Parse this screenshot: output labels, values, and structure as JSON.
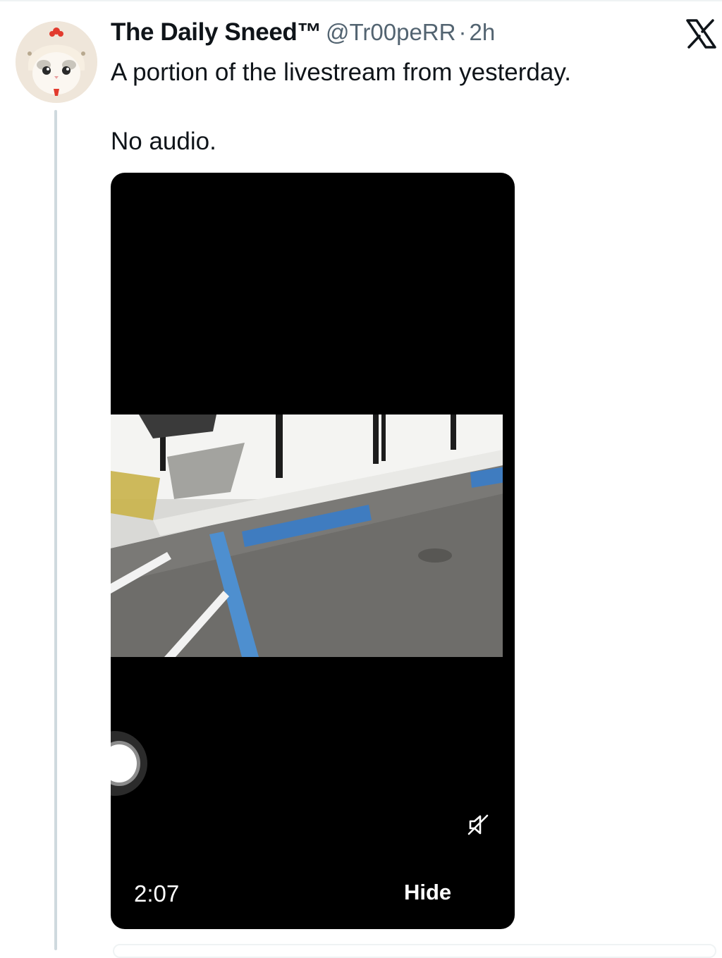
{
  "tweet": {
    "display_name": "The Daily Sneed™",
    "handle": "@Tr00peRR",
    "separator": "·",
    "time": "2h",
    "text_line_1": "A portion of the livestream from yesterday.",
    "text_line_2": "No audio."
  },
  "video": {
    "duration": "2:07",
    "hide_label": "Hide",
    "muted": true
  },
  "icons": {
    "avatar": "cat-in-chicken-hat-avatar",
    "brand": "x-logo-icon",
    "mute": "speaker-muted-icon",
    "record": "record-button-icon"
  },
  "colors": {
    "text_primary": "#0f1419",
    "text_secondary": "#536471",
    "thread_line": "#cfd9de",
    "video_bg": "#000000"
  }
}
